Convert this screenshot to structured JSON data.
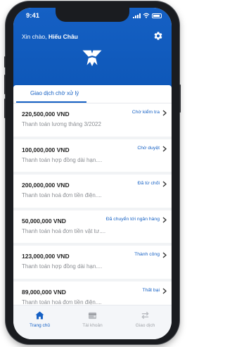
{
  "status_bar": {
    "time": "9:41"
  },
  "header": {
    "greeting_prefix": "Xin chào,",
    "user_name": "Hiếu Châu",
    "settings_icon": "gear-icon",
    "logo_icon": "brand-logo-icon",
    "brand_color": "#1560c4"
  },
  "tab": {
    "label": "Giao dịch chờ xử lý"
  },
  "transactions": [
    {
      "amount": "220,500,000 VND",
      "description": "Thanh toán lương tháng 3/2022",
      "status": "Chờ kiểm tra"
    },
    {
      "amount": "100,000,000 VND",
      "description": "Thanh toán hợp đồng dài hạn....",
      "status": "Chờ duyệt"
    },
    {
      "amount": "200,000,000 VND",
      "description": "Thanh toán hoá đơn tiền điện....",
      "status": "Đã từ chối"
    },
    {
      "amount": "50,000,000 VND",
      "description": "Thanh toán hoá đơn tiền vật tư....",
      "status": "Đã chuyển tới ngân hàng"
    },
    {
      "amount": "123,000,000 VND",
      "description": "Thanh toán hợp đồng dài hạn....",
      "status": "Thành công"
    },
    {
      "amount": "89,000,000 VND",
      "description": "Thanh toán hoá đơn tiền điện....",
      "status": "Thất bại"
    }
  ],
  "bottom_nav": {
    "items": [
      {
        "label": "Trang chủ",
        "icon": "home-icon",
        "active": true
      },
      {
        "label": "Tài khoản",
        "icon": "wallet-icon",
        "active": false
      },
      {
        "label": "Giao dịch",
        "icon": "transfer-icon",
        "active": false
      }
    ]
  }
}
